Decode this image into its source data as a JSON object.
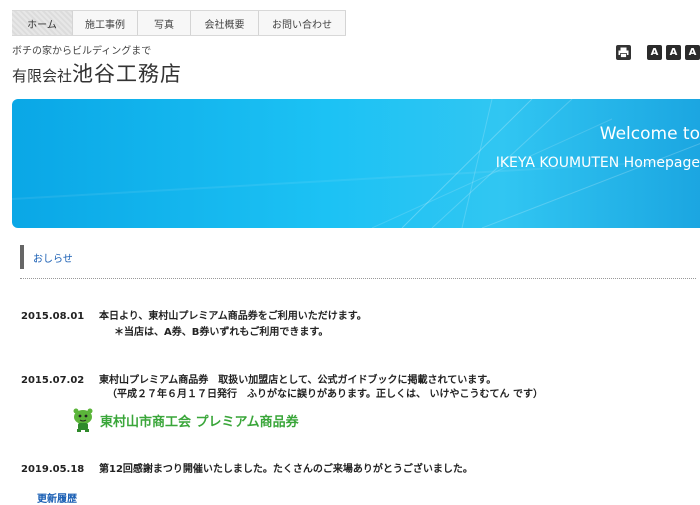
{
  "nav": {
    "tabs": [
      {
        "label": "ホーム"
      },
      {
        "label": "施工事例"
      },
      {
        "label": "写真"
      },
      {
        "label": "会社概要"
      },
      {
        "label": "お問い合わせ"
      }
    ]
  },
  "header": {
    "tagline": "ボチの家からビルディングまで",
    "company_prefix": "有限会社",
    "company_name": "池谷工務店"
  },
  "tools": {
    "font_small": "A",
    "font_medium": "A",
    "font_large": "A"
  },
  "hero": {
    "welcome": "Welcome to",
    "site": "IKEYA KOUMUTEN Homepage"
  },
  "news": {
    "heading": "おしらせ",
    "items": [
      {
        "date": "2015.08.01",
        "text": "本日より、東村山プレミアム商品券をご利用いただけます。",
        "sub": "＊当店は、A券、B券いずれもご利用できます。"
      },
      {
        "date": "2015.07.02",
        "text": "東村山プレミアム商品券　取扱い加盟店として、公式ガイドブックに掲載されています。",
        "sub": "（平成２７年６月１７日発行　ふりがなに誤りがあります。正しくは、 いけやこうむてん です）"
      },
      {
        "date": "2019.05.18",
        "text": "第12回感謝まつり開催いたしました。たくさんのご来場ありがとうございました。"
      }
    ],
    "promo_text": "東村山市商工会 プレミアム商品券",
    "more_label": "更新履歴"
  }
}
